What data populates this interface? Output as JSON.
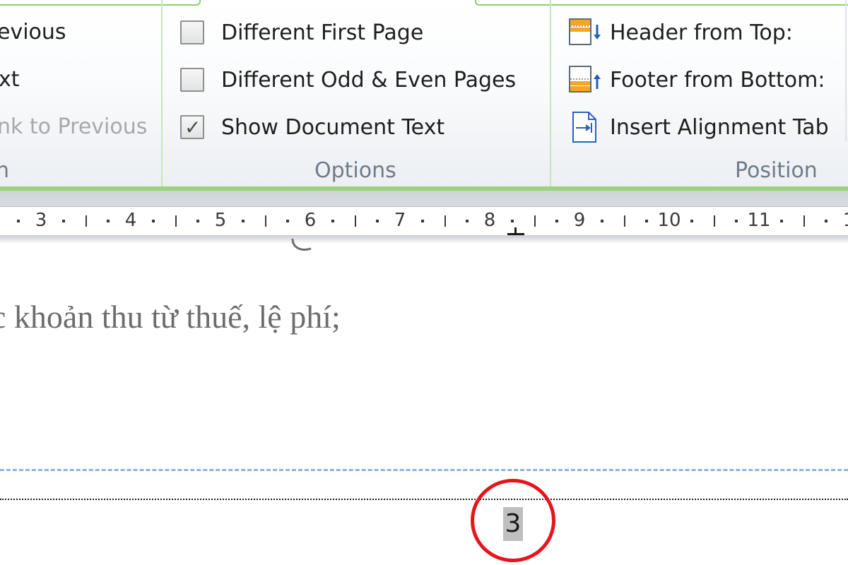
{
  "navigation": {
    "items": [
      {
        "label": "evious",
        "enabled": true
      },
      {
        "label": "xt",
        "enabled": true
      },
      {
        "label": "nk to Previous",
        "enabled": false
      }
    ],
    "group_label": "n"
  },
  "options": {
    "group_label": "Options",
    "items": [
      {
        "label": "Different First Page",
        "checked": false
      },
      {
        "label": "Different Odd & Even Pages",
        "checked": false
      },
      {
        "label": "Show Document Text",
        "checked": true
      }
    ]
  },
  "position": {
    "group_label": "Position",
    "items": [
      {
        "label": "Header from Top:",
        "icon": "header-from-top-icon"
      },
      {
        "label": "Footer from Bottom:",
        "icon": "footer-from-bottom-icon"
      },
      {
        "label": "Insert Alignment Tab",
        "icon": "insert-alignment-tab-icon"
      }
    ]
  },
  "ruler": {
    "numbers": [
      "3",
      "4",
      "5",
      "6",
      "7",
      "8",
      "9",
      "10",
      "11",
      "1"
    ]
  },
  "document": {
    "body_text": "c khoản thu từ thuế, lệ phí;",
    "page_number": "3"
  },
  "colors": {
    "accent_green": "#9bd27f",
    "highlight_circle": "#e8141b",
    "header_boundary": "#8fb2da"
  }
}
